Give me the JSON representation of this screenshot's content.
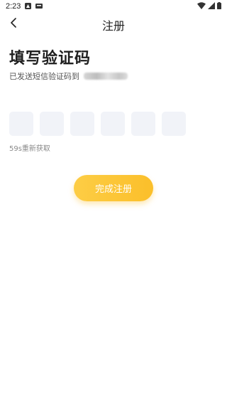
{
  "status_bar": {
    "time": "2:23",
    "icons": [
      "notification-a-icon",
      "notification-box-icon",
      "wifi-icon",
      "cell-signal-icon",
      "battery-icon"
    ]
  },
  "nav": {
    "back_icon": "chevron-left-icon",
    "title": "注册"
  },
  "main": {
    "heading": "填写验证码",
    "sent_prefix": "已发送短信验证码到",
    "code_digits": [
      "",
      "",
      "",
      "",
      "",
      ""
    ],
    "resend": "59s重新获取",
    "submit_label": "完成注册"
  },
  "colors": {
    "accent_start": "#fdcd45",
    "accent_end": "#fbbf2a",
    "code_box_bg": "#f1f3f8"
  }
}
